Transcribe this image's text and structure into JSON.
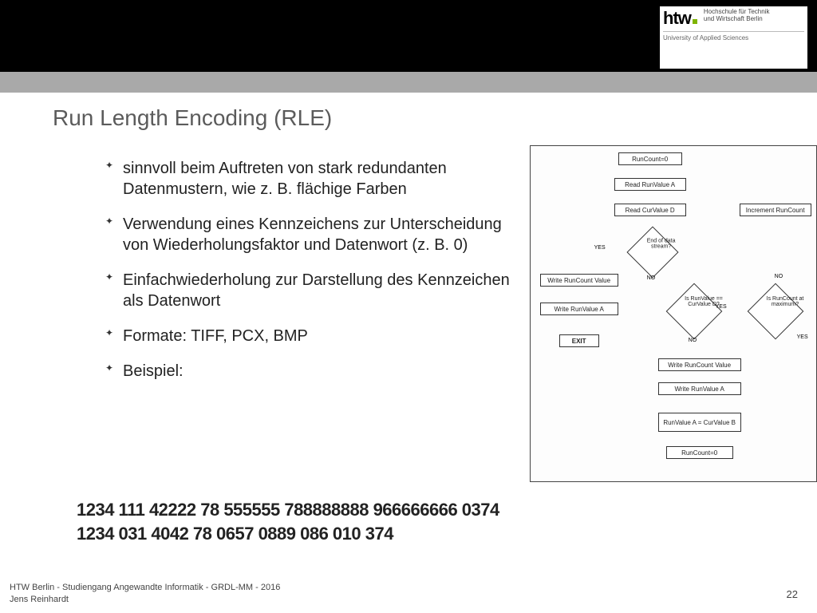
{
  "header": {
    "logo_mark": "htw",
    "logo_text_line1": "Hochschule für Technik",
    "logo_text_line2": "und Wirtschaft Berlin",
    "logo_sub": "University of Applied Sciences"
  },
  "title": "Run Length Encoding (RLE)",
  "bullets": [
    "sinnvoll beim Auftreten von stark redundanten Datenmustern, wie z. B. flächige Farben",
    "Verwendung eines Kennzeichens zur Unterscheidung von Wiederholungsfaktor und Datenwort (z. B. 0)",
    "Einfachwiederholung zur Darstellung des Kennzeichen als Datenwort",
    "Formate: TIFF, PCX, BMP",
    "Beispiel:"
  ],
  "example": {
    "line1": "1234 111 42222 78 555555 788888888 966666666 0374",
    "line2": "1234 031 4042 78 0657 0889 086 010 374"
  },
  "flowchart": {
    "nodes": {
      "n1": "RunCount=0",
      "n2": "Read RunValue A",
      "n3": "Read CurValue D",
      "d1": "End of data stream?",
      "n4": "Write RunCount Value",
      "n5": "Write RunValue A",
      "exit": "EXIT",
      "d2": "Is RunValue == CurValue D?",
      "d3": "Is RunCount at maximum?",
      "n6": "Increment RunCount",
      "n7": "Write RunCount Value",
      "n8": "Write RunValue A",
      "n9": "RunValue A = CurValue B",
      "n10": "RunCount=0"
    },
    "labels": {
      "yes": "YES",
      "no": "NO"
    }
  },
  "footer": {
    "line1": "HTW Berlin - Studiengang Angewandte Informatik - GRDL-MM - 2016",
    "line2": "Jens Reinhardt"
  },
  "page_number": "22"
}
